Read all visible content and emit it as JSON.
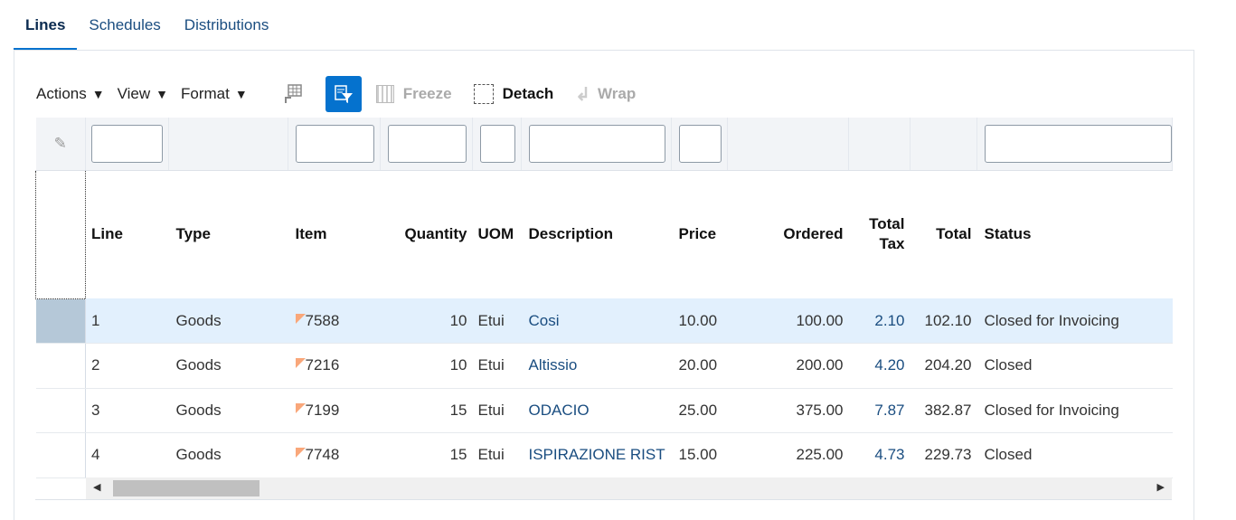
{
  "tabs": [
    {
      "label": "Lines"
    },
    {
      "label": "Schedules"
    },
    {
      "label": "Distributions"
    }
  ],
  "toolbar": {
    "actions": "Actions",
    "view": "View",
    "format": "Format",
    "freeze": "Freeze",
    "detach": "Detach",
    "wrap": "Wrap"
  },
  "columns": {
    "line": "Line",
    "type": "Type",
    "item": "Item",
    "quantity": "Quantity",
    "uom": "UOM",
    "description": "Description",
    "price": "Price",
    "ordered": "Ordered",
    "total_tax_1": "Total",
    "total_tax_2": "Tax",
    "total": "Total",
    "status": "Status"
  },
  "rows": [
    {
      "line": "1",
      "type": "Goods",
      "item": "7588",
      "quantity": "10",
      "uom": "Etui",
      "description": "Cosi",
      "price": "10.00",
      "ordered": "100.00",
      "total_tax": "2.10",
      "total": "102.10",
      "status": "Closed for Invoicing"
    },
    {
      "line": "2",
      "type": "Goods",
      "item": "7216",
      "quantity": "10",
      "uom": "Etui",
      "description": "Altissio",
      "price": "20.00",
      "ordered": "200.00",
      "total_tax": "4.20",
      "total": "204.20",
      "status": "Closed"
    },
    {
      "line": "3",
      "type": "Goods",
      "item": "7199",
      "quantity": "15",
      "uom": "Etui",
      "description": "ODACIO",
      "price": "25.00",
      "ordered": "375.00",
      "total_tax": "7.87",
      "total": "382.87",
      "status": "Closed for Invoicing"
    },
    {
      "line": "4",
      "type": "Goods",
      "item": "7748",
      "quantity": "15",
      "uom": "Etui",
      "description": "ISPIRAZIONE RIST",
      "price": "15.00",
      "ordered": "225.00",
      "total_tax": "4.73",
      "total": "229.73",
      "status": "Closed"
    }
  ],
  "colors": {
    "accent": "#0572ce",
    "link": "#1a4d80",
    "selected_row": "#e2f0fd"
  }
}
